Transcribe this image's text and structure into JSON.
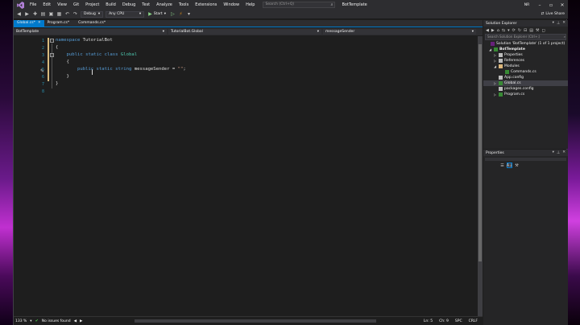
{
  "menu": {
    "items": [
      "File",
      "Edit",
      "View",
      "Git",
      "Project",
      "Build",
      "Debug",
      "Test",
      "Analyze",
      "Tools",
      "Extensions",
      "Window",
      "Help"
    ],
    "search_placeholder": "Search (Ctrl+Q)",
    "app_title": "BotTemplate",
    "avatar": "NR"
  },
  "toolbar": {
    "config": "Debug",
    "platform": "Any CPU",
    "start": "Start",
    "live_share": "Live Share"
  },
  "tabs": [
    {
      "label": "Global.cs*",
      "active": true
    },
    {
      "label": "Program.cs*",
      "active": false
    },
    {
      "label": "Commands.cs*",
      "active": false
    }
  ],
  "navbar": {
    "project": "BotTemplate",
    "type": "TutorialBot.Global",
    "member": "messageSender"
  },
  "code": {
    "line_numbers": [
      "1",
      "2",
      "3",
      "4",
      "5",
      "6",
      "7",
      "8"
    ],
    "lines": [
      [
        {
          "t": "namespace",
          "k": "kw"
        },
        {
          "t": " TutorialBot",
          "k": ""
        }
      ],
      [
        {
          "t": "{",
          "k": ""
        }
      ],
      [
        {
          "t": "    ",
          "k": ""
        },
        {
          "t": "public",
          "k": "kw"
        },
        {
          "t": " ",
          "k": ""
        },
        {
          "t": "static",
          "k": "kw"
        },
        {
          "t": " ",
          "k": ""
        },
        {
          "t": "class",
          "k": "kw"
        },
        {
          "t": " ",
          "k": ""
        },
        {
          "t": "Global",
          "k": "cls"
        }
      ],
      [
        {
          "t": "    {",
          "k": ""
        }
      ],
      [
        {
          "t": "        ",
          "k": ""
        },
        {
          "t": "public",
          "k": "kw"
        },
        {
          "t": " ",
          "k": ""
        },
        {
          "t": "static",
          "k": "kw"
        },
        {
          "t": " ",
          "k": ""
        },
        {
          "t": "string",
          "k": "kw"
        },
        {
          "t": " messageSender = ",
          "k": ""
        },
        {
          "t": "\"\"",
          "k": "str"
        },
        {
          "t": ";",
          "k": ""
        }
      ],
      [
        {
          "t": "    }",
          "k": ""
        }
      ],
      [
        {
          "t": "}",
          "k": ""
        }
      ],
      [
        {
          "t": "",
          "k": ""
        }
      ]
    ]
  },
  "status": {
    "zoom": "133 %",
    "issues": "No issues found",
    "ln": "Ln: 5",
    "ch": "Ch: 9",
    "spc": "SPC",
    "crlf": "CRLF"
  },
  "solution_explorer": {
    "title": "Solution Explorer",
    "search_placeholder": "Search Solution Explorer (Ctrl+;)",
    "items": [
      {
        "label": "Solution 'BotTemplate' (1 of 1 project)",
        "icon": "solution-icon"
      },
      {
        "label": "BotTemplate",
        "icon": "csharp-project-icon",
        "bold": true
      },
      {
        "label": "Properties",
        "icon": "wrench-icon"
      },
      {
        "label": "References",
        "icon": "references-icon"
      },
      {
        "label": "Modules",
        "icon": "folder-icon"
      },
      {
        "label": "Commands.cs",
        "icon": "csharp-file-icon"
      },
      {
        "label": "App.config",
        "icon": "config-file-icon"
      },
      {
        "label": "Global.cs",
        "icon": "csharp-file-icon",
        "selected": true
      },
      {
        "label": "packages.config",
        "icon": "config-file-icon"
      },
      {
        "label": "Program.cs",
        "icon": "csharp-file-icon"
      }
    ]
  },
  "properties": {
    "title": "Properties"
  },
  "colors": {
    "accent": "#007acc",
    "keyword": "#569cd6",
    "type": "#4ec9b0",
    "string": "#d69d85",
    "line_number": "#2b91af",
    "change_marker": "#d7ba7d"
  }
}
